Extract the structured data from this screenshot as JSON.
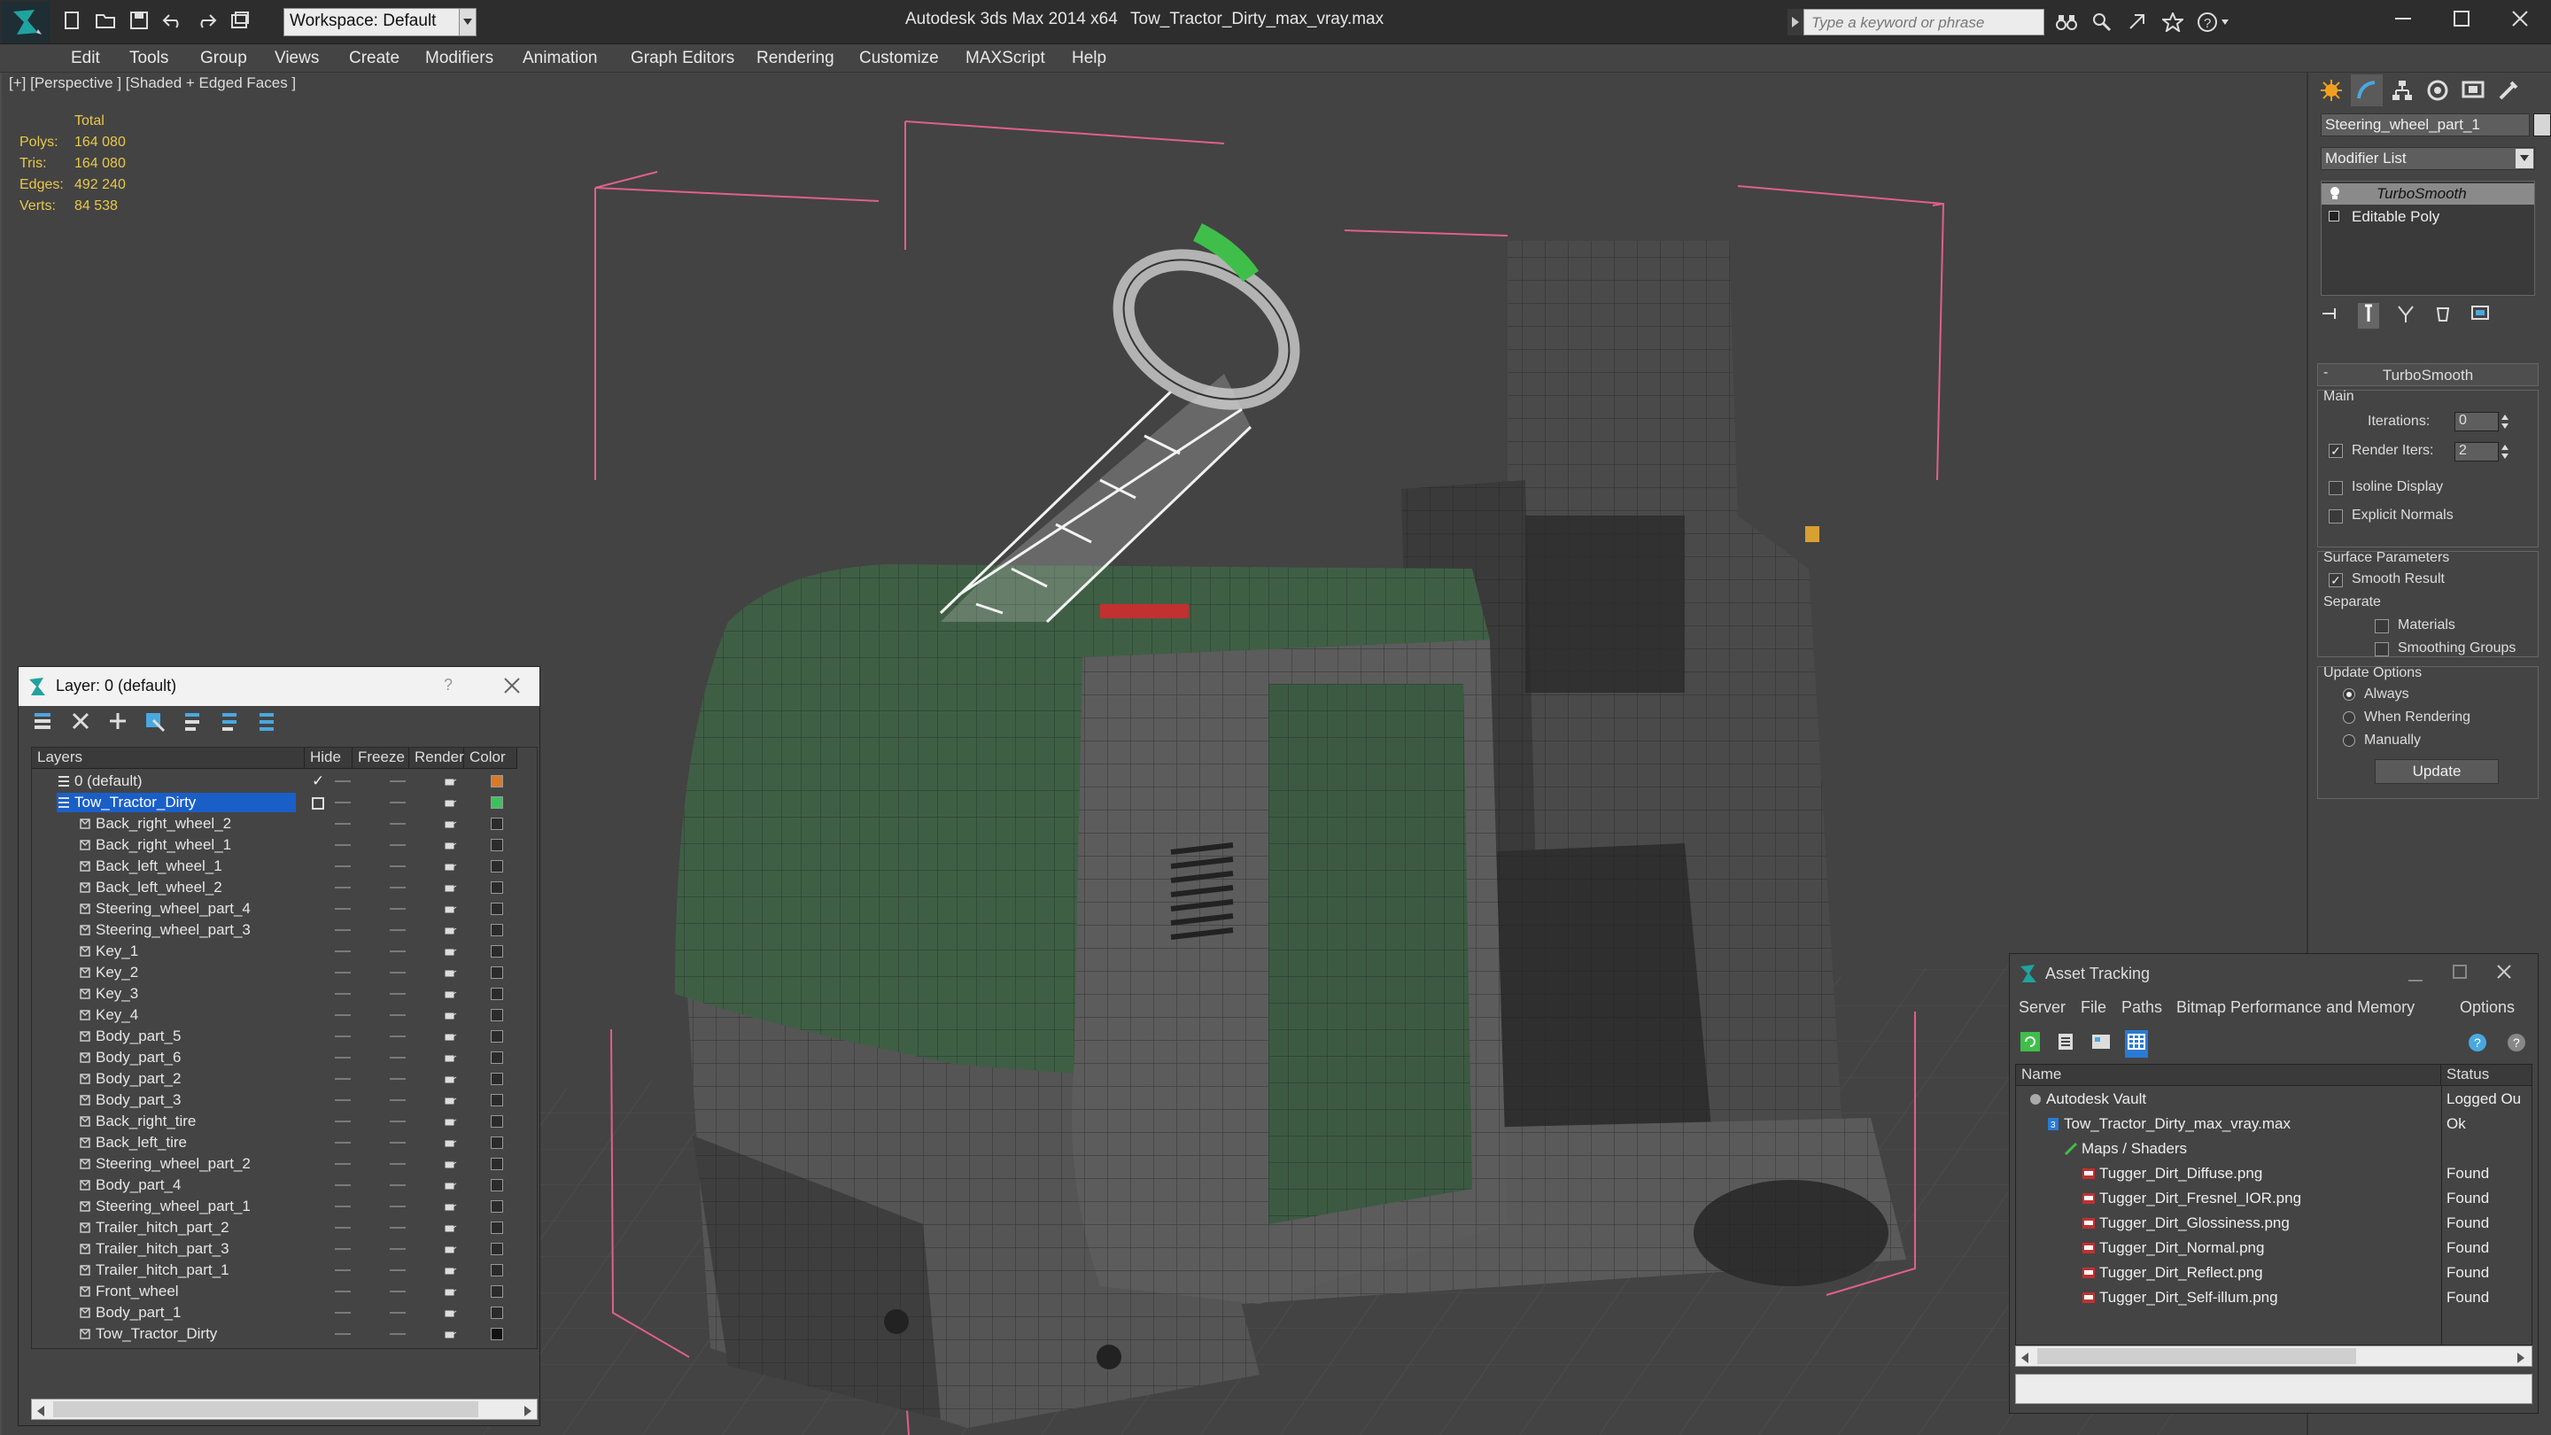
{
  "titlebar": {
    "app_title": "Autodesk 3ds Max  2014 x64",
    "file_title": "Tow_Tractor_Dirty_max_vray.max",
    "workspace_label": "Workspace: Default",
    "search_placeholder": "Type a keyword or phrase"
  },
  "menubar": {
    "items": [
      "Edit",
      "Tools",
      "Group",
      "Views",
      "Create",
      "Modifiers",
      "Animation",
      "Graph Editors",
      "Rendering",
      "Customize",
      "MAXScript",
      "Help"
    ]
  },
  "viewport": {
    "label": "[+] [Perspective ] [Shaded + Edged Faces ]",
    "stats": {
      "header": "Total",
      "rows": [
        {
          "label": "Polys:",
          "value": "164 080"
        },
        {
          "label": "Tris:",
          "value": "164 080"
        },
        {
          "label": "Edges:",
          "value": "492 240"
        },
        {
          "label": "Verts:",
          "value": "84 538"
        }
      ]
    }
  },
  "command_panel": {
    "object_name": "Steering_wheel_part_1",
    "modifier_list": "Modifier List",
    "stack": [
      "TurboSmooth",
      "Editable Poly"
    ],
    "turbosmooth": {
      "title": "TurboSmooth",
      "main_group": "Main",
      "iterations_label": "Iterations:",
      "iterations_value": "0",
      "render_iters_label": "Render Iters:",
      "render_iters_value": "2",
      "isoline_label": "Isoline Display",
      "explicit_label": "Explicit Normals",
      "surface_group": "Surface Parameters",
      "smooth_result_label": "Smooth Result",
      "separate_label": "Separate",
      "materials_label": "Materials",
      "smoothing_groups_label": "Smoothing Groups",
      "update_group": "Update Options",
      "always_label": "Always",
      "when_rendering_label": "When Rendering",
      "manually_label": "Manually",
      "update_button": "Update"
    }
  },
  "layer_explorer": {
    "title": "Layer: 0 (default)",
    "help_glyph": "?",
    "columns": [
      "Layers",
      "Hide",
      "Freeze",
      "Render",
      "Color"
    ],
    "rows": [
      {
        "name": "0 (default)",
        "level": 0,
        "color": "#d87a2a"
      },
      {
        "name": "Tow_Tractor_Dirty",
        "level": 0,
        "color": "#3fc060",
        "selected": true
      },
      {
        "name": "Back_right_wheel_2",
        "level": 1
      },
      {
        "name": "Back_right_wheel_1",
        "level": 1
      },
      {
        "name": "Back_left_wheel_1",
        "level": 1
      },
      {
        "name": "Back_left_wheel_2",
        "level": 1
      },
      {
        "name": "Steering_wheel_part_4",
        "level": 1
      },
      {
        "name": "Steering_wheel_part_3",
        "level": 1
      },
      {
        "name": "Key_1",
        "level": 1
      },
      {
        "name": "Key_2",
        "level": 1
      },
      {
        "name": "Key_3",
        "level": 1
      },
      {
        "name": "Key_4",
        "level": 1
      },
      {
        "name": "Body_part_5",
        "level": 1
      },
      {
        "name": "Body_part_6",
        "level": 1
      },
      {
        "name": "Body_part_2",
        "level": 1
      },
      {
        "name": "Body_part_3",
        "level": 1
      },
      {
        "name": "Back_right_tire",
        "level": 1
      },
      {
        "name": "Back_left_tire",
        "level": 1
      },
      {
        "name": "Steering_wheel_part_2",
        "level": 1
      },
      {
        "name": "Body_part_4",
        "level": 1
      },
      {
        "name": "Steering_wheel_part_1",
        "level": 1
      },
      {
        "name": "Trailer_hitch_part_2",
        "level": 1
      },
      {
        "name": "Trailer_hitch_part_3",
        "level": 1
      },
      {
        "name": "Trailer_hitch_part_1",
        "level": 1
      },
      {
        "name": "Front_wheel",
        "level": 1
      },
      {
        "name": "Body_part_1",
        "level": 1
      },
      {
        "name": "Tow_Tractor_Dirty",
        "level": 1,
        "color": "#111111"
      }
    ]
  },
  "asset_tracking": {
    "title": "Asset Tracking",
    "menu": [
      "Server",
      "File",
      "Paths",
      "Bitmap Performance and Memory",
      "Options"
    ],
    "columns": [
      "Name",
      "Status"
    ],
    "rows": [
      {
        "name": "Autodesk Vault",
        "status": "Logged Ou",
        "level": 0
      },
      {
        "name": "Tow_Tractor_Dirty_max_vray.max",
        "status": "Ok",
        "level": 1
      },
      {
        "name": "Maps / Shaders",
        "status": "",
        "level": 2
      },
      {
        "name": "Tugger_Dirt_Diffuse.png",
        "status": "Found",
        "level": 3
      },
      {
        "name": "Tugger_Dirt_Fresnel_IOR.png",
        "status": "Found",
        "level": 3
      },
      {
        "name": "Tugger_Dirt_Glossiness.png",
        "status": "Found",
        "level": 3
      },
      {
        "name": "Tugger_Dirt_Normal.png",
        "status": "Found",
        "level": 3
      },
      {
        "name": "Tugger_Dirt_Reflect.png",
        "status": "Found",
        "level": 3
      },
      {
        "name": "Tugger_Dirt_Self-illum.png",
        "status": "Found",
        "level": 3
      }
    ]
  },
  "colors": {
    "accent": "#2a7ad4",
    "selection": "#1a5fc8",
    "stat_yellow": "#e8c84a",
    "bbox_pink": "#e0608a",
    "body_green": "#3f5f45"
  }
}
